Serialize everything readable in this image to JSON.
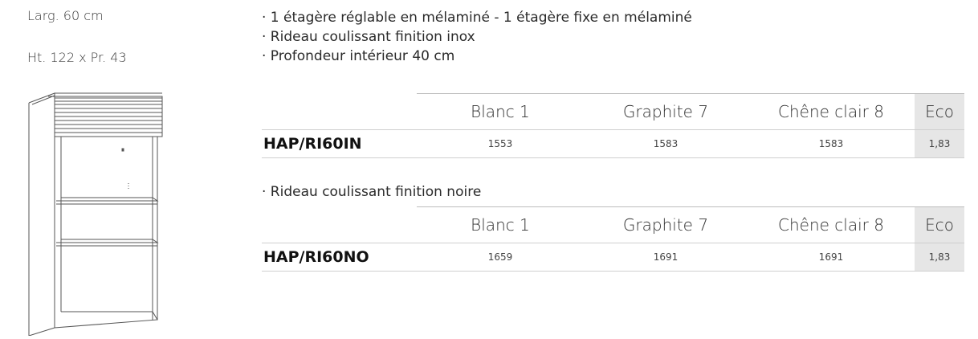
{
  "dimensions": {
    "width": "Larg. 60 cm",
    "height_depth": "Ht. 122 x Pr. 43"
  },
  "features": [
    "· 1 étagère réglable en mélaminé - 1 étagère fixe en mélaminé",
    "· Rideau coulissant finition inox",
    "· Profondeur intérieur 40 cm"
  ],
  "columns": [
    "Blanc 1",
    "Graphite 7",
    "Chêne clair 8",
    "Eco"
  ],
  "table1": {
    "ref": "HAP/RI60IN",
    "prices": [
      "1553",
      "1583",
      "1583"
    ],
    "eco": "1,83"
  },
  "variant_note": "· Rideau coulissant finition noire",
  "table2": {
    "ref": "HAP/RI60NO",
    "prices": [
      "1659",
      "1691",
      "1691"
    ],
    "eco": "1,83"
  }
}
